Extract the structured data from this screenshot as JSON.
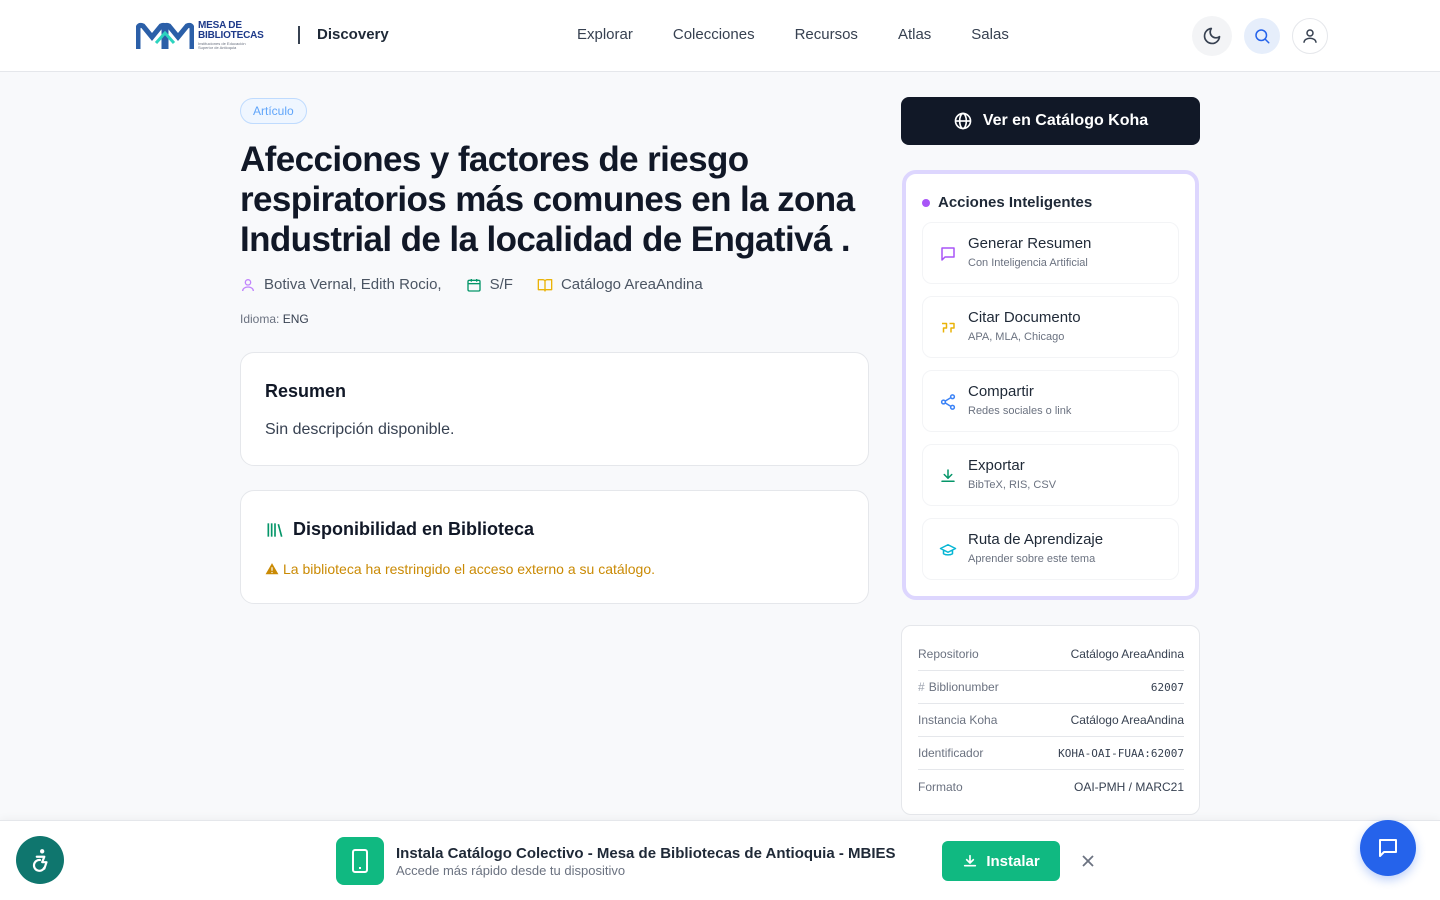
{
  "header": {
    "logo": {
      "line1": "MESA DE",
      "line2": "BIBLIOTECAS",
      "line3": "Instituciones de Educación Superior de Antioquia"
    },
    "brand": "Discovery",
    "nav": [
      "Explorar",
      "Colecciones",
      "Recursos",
      "Atlas",
      "Salas"
    ],
    "icons": {
      "theme": "moon-icon",
      "search": "search-icon",
      "user": "user-icon"
    }
  },
  "record": {
    "type_tag": "Artículo",
    "title": "Afecciones y factores de riesgo respiratorios más comunes en la zona Industrial de la localidad de Engativá .",
    "author": "Botiva Vernal, Edith Rocio,",
    "date": "S/F",
    "catalog": "Catálogo AreaAndina",
    "language_label": "Idioma:",
    "language_value": "ENG"
  },
  "summary": {
    "heading": "Resumen",
    "text": "Sin descripción disponible."
  },
  "availability": {
    "heading": "Disponibilidad en Biblioteca",
    "warning": "La biblioteca ha restringido el acceso externo a su catálogo."
  },
  "sidebar": {
    "koha_button": "Ver en Catálogo Koha",
    "ai_title": "Acciones Inteligentes",
    "actions": [
      {
        "title": "Generar Resumen",
        "subtitle": "Con Inteligencia Artificial",
        "icon": "message-icon",
        "color": "#a855f7"
      },
      {
        "title": "Citar Documento",
        "subtitle": "APA, MLA, Chicago",
        "icon": "quote-icon",
        "color": "#eab308"
      },
      {
        "title": "Compartir",
        "subtitle": "Redes sociales o link",
        "icon": "share-icon",
        "color": "#3b82f6"
      },
      {
        "title": "Exportar",
        "subtitle": "BibTeX, RIS, CSV",
        "icon": "download-icon",
        "color": "#059669"
      },
      {
        "title": "Ruta de Aprendizaje",
        "subtitle": "Aprender sobre este tema",
        "icon": "graduation-cap-icon",
        "color": "#06b6d4"
      }
    ],
    "details": [
      {
        "key": "Repositorio",
        "value": "Catálogo AreaAndina"
      },
      {
        "key": "Biblionumber",
        "value": "62007"
      },
      {
        "key": "Instancia Koha",
        "value": "Catálogo AreaAndina"
      },
      {
        "key": "Identificador",
        "value": "KOHA-OAI-FUAA:62007"
      },
      {
        "key": "Formato",
        "value": "OAI-PMH / MARC21"
      }
    ]
  },
  "install_banner": {
    "title": "Instala Catálogo Colectivo - Mesa de Bibliotecas de Antioquia - MBIES",
    "subtitle": "Accede más rápido desde tu dispositivo",
    "button": "Instalar"
  },
  "colors": {
    "accent_green": "#10b981",
    "dark": "#111827",
    "ai_border": "#ddd6fe",
    "warning": "#ca8a04"
  }
}
